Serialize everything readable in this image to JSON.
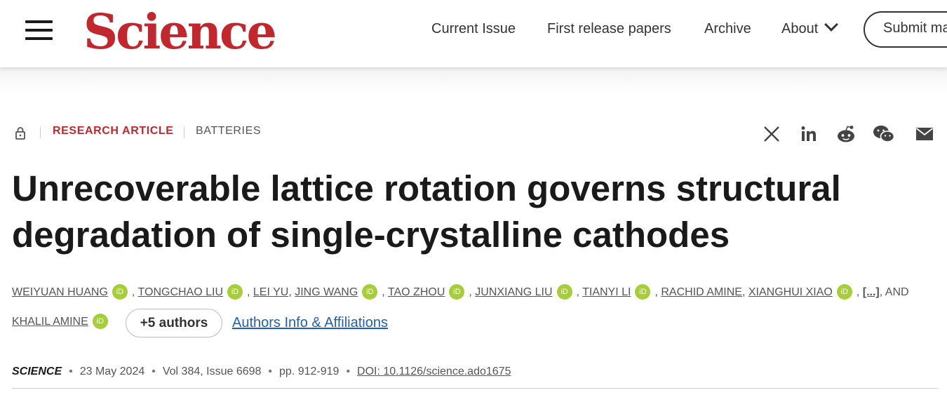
{
  "header": {
    "logo": "Science",
    "nav": [
      {
        "label": "Current Issue"
      },
      {
        "label": "First release papers"
      },
      {
        "label": "Archive"
      },
      {
        "label": "About"
      }
    ],
    "submit_label": "Submit manuscript"
  },
  "article": {
    "access_icon": "lock-icon",
    "type": "RESEARCH ARTICLE",
    "subject": "BATTERIES",
    "title": "Unrecoverable lattice rotation governs structural degradation of single-crystalline cathodes",
    "authors": [
      {
        "name": "WEIYUAN HUANG",
        "orcid": true
      },
      {
        "name": "TONGCHAO LIU",
        "orcid": true
      },
      {
        "name": "LEI YU",
        "orcid": false
      },
      {
        "name": "JING WANG",
        "orcid": true
      },
      {
        "name": "TAO ZHOU",
        "orcid": true
      },
      {
        "name": "JUNXIANG LIU",
        "orcid": true
      },
      {
        "name": "TIANYI LI",
        "orcid": true
      },
      {
        "name": "RACHID AMINE",
        "orcid": false
      },
      {
        "name": "XIANGHUI XIAO",
        "orcid": true
      }
    ],
    "ellipsis": "[...]",
    "and_label": "AND",
    "last_author": "KHALIL AMINE",
    "orcid_label": "iD",
    "more_authors": "+5 authors",
    "affiliations_link": "Authors Info & Affiliations",
    "journal": "SCIENCE",
    "date": "23 May 2024",
    "volume": "Vol 384, Issue 6698",
    "pages": "pp. 912-919",
    "doi": "DOI: 10.1126/science.ado1675"
  },
  "share_icons": [
    "x-icon",
    "linkedin-icon",
    "reddit-icon",
    "wechat-icon",
    "email-icon"
  ],
  "colors": {
    "brand_red": "#c1272d",
    "orcid_green": "#a6ce39",
    "link_blue": "#1f5fb5"
  }
}
